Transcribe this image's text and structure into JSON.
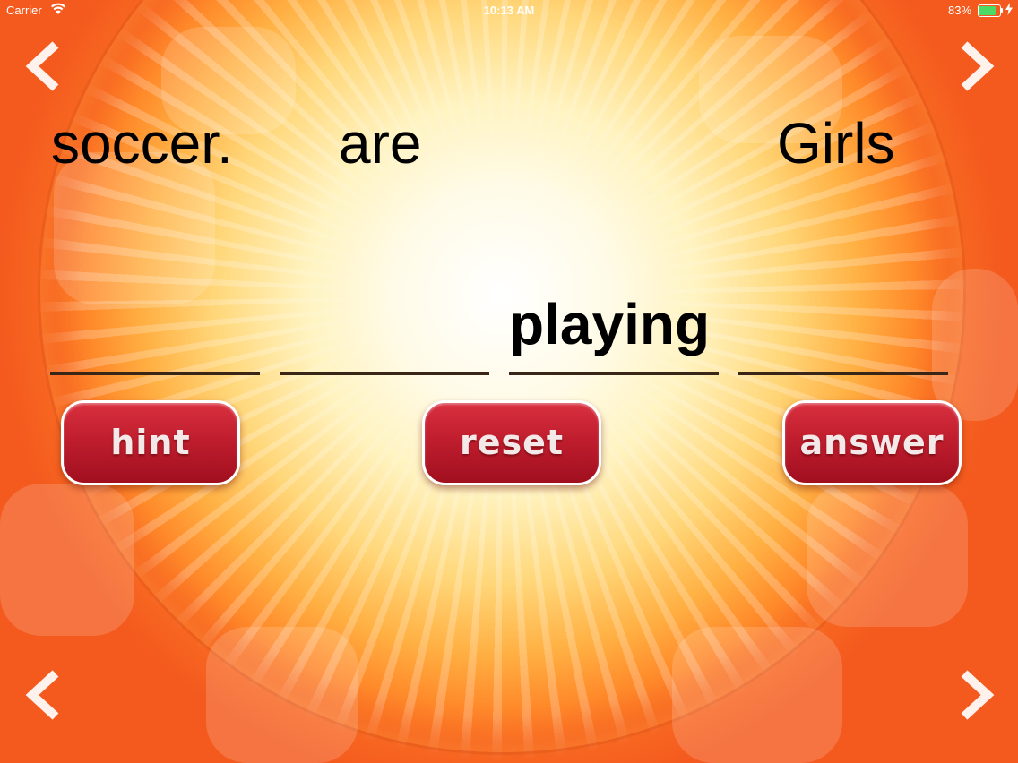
{
  "status_bar": {
    "carrier": "Carrier",
    "time": "10:13 AM",
    "battery_percent": "83%",
    "battery_level": 0.83,
    "battery_color": "#4cd964",
    "wifi_icon": "wifi-icon",
    "charging_icon": "bolt-icon"
  },
  "navigation": {
    "back_icon": "chevron-left-icon",
    "forward_icon": "chevron-right-icon"
  },
  "puzzle": {
    "scrambled_words": [
      "soccer.",
      "are",
      "Girls"
    ],
    "placed_words": [
      "",
      "",
      "playing",
      ""
    ]
  },
  "buttons": {
    "hint": "hint",
    "reset": "reset",
    "answer": "answer"
  },
  "colors": {
    "background": "#f45a1e",
    "button": "#c01e2e",
    "slot_line": "#3a2616"
  }
}
